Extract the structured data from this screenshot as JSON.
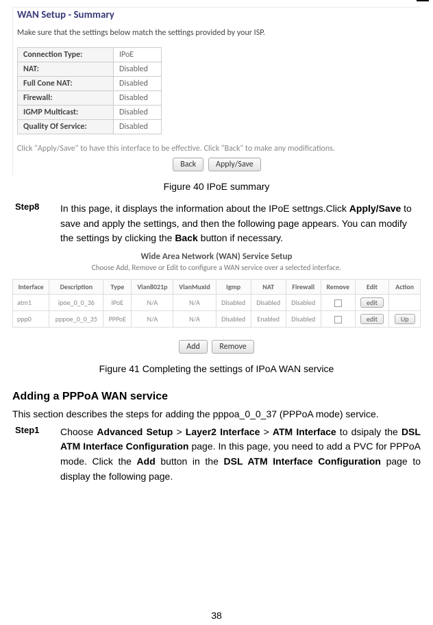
{
  "wan_summary": {
    "title": "WAN Setup - Summary",
    "note": "Make sure that the settings below match the settings provided by your ISP.",
    "rows": [
      {
        "label": "Connection Type:",
        "value": "IPoE"
      },
      {
        "label": "NAT:",
        "value": "Disabled"
      },
      {
        "label": "Full Cone NAT:",
        "value": "Disabled"
      },
      {
        "label": "Firewall:",
        "value": "Disabled"
      },
      {
        "label": "IGMP Multicast:",
        "value": "Disabled"
      },
      {
        "label": "Quality Of Service:",
        "value": "Disabled"
      }
    ],
    "footer_note": "Click \"Apply/Save\" to have this interface to be effective. Click \"Back\" to make any modifications.",
    "btn_back": "Back",
    "btn_apply": "Apply/Save"
  },
  "figcap1": "Figure 40 IPoE summary",
  "step8": {
    "label": "Step8",
    "t1": "In this page, it displays the information about the IPoE settngs.Click ",
    "b1": "Apply/Save",
    "t2": " to save and apply the settings, and then the following page appears. You can modify the settings by clicking the ",
    "b2": "Back",
    "t3": " button if necessary."
  },
  "wan_service": {
    "title": "Wide Area Network (WAN) Service Setup",
    "sub": "Choose Add, Remove or Edit to configure a WAN service over a selected interface.",
    "headers": [
      "Interface",
      "Description",
      "Type",
      "Vlan8021p",
      "VlanMuxId",
      "Igmp",
      "NAT",
      "Firewall",
      "Remove",
      "Edit",
      "Action"
    ],
    "rows": [
      {
        "c0": "atm1",
        "c1": "ipoe_0_0_36",
        "c2": "IPoE",
        "c3": "N/A",
        "c4": "N/A",
        "c5": "Disabled",
        "c6": "Disabled",
        "c7": "Disabled",
        "edit": "edit",
        "action": ""
      },
      {
        "c0": "ppp0",
        "c1": "pppoe_0_0_35",
        "c2": "PPPoE",
        "c3": "N/A",
        "c4": "N/A",
        "c5": "Disabled",
        "c6": "Enabled",
        "c7": "Disabled",
        "edit": "edit",
        "action": "Up"
      }
    ],
    "btn_add": "Add",
    "btn_remove": "Remove"
  },
  "figcap2": "Figure 41 Completing the settings of IPoA WAN service",
  "heading": "Adding a PPPoA WAN service",
  "intro": "This section describes the steps for adding the pppoa_0_0_37 (PPPoA mode) service.",
  "step1": {
    "label": "Step1",
    "t1": "Choose ",
    "b1": "Advanced Setup",
    "t2": " > ",
    "b2": "Layer2 Interface",
    "t3": " > ",
    "b3": "ATM Interface",
    "t4": " to dsipaly the ",
    "b4": "DSL ATM Interface Configuration",
    "t5": " page. In this page, you need to add a PVC for PPPoA mode. Click the ",
    "b5": "Add",
    "t6": " button in the ",
    "b6": "DSL ATM Interface Configuration",
    "t7": " page to display the following page."
  },
  "page_num": "38"
}
